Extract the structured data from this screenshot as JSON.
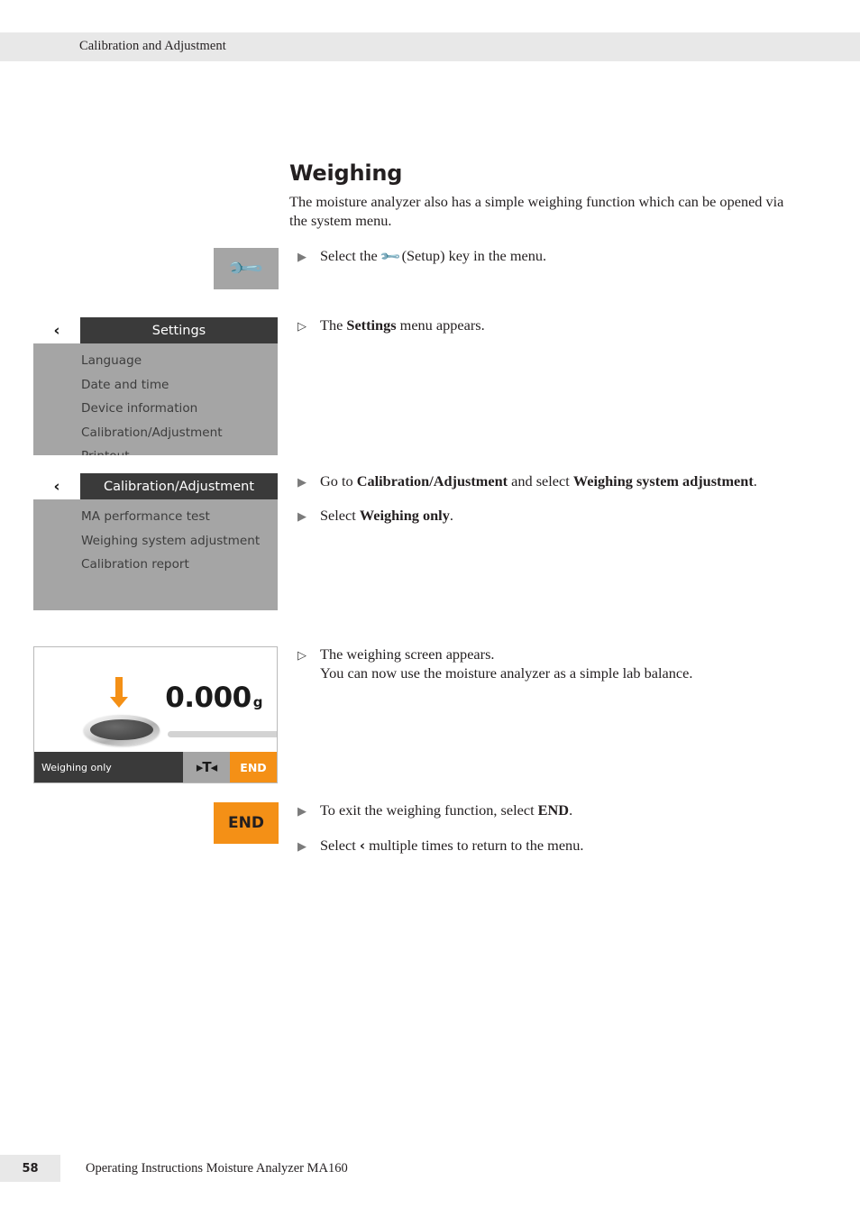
{
  "header": {
    "chapter": "Calibration and Adjustment"
  },
  "section": {
    "title": "Weighing",
    "intro": "The moisture analyzer also has a simple weighing function which can be opened via the system menu."
  },
  "steps": {
    "setup": {
      "marker": "▶",
      "prefix": "Select the ",
      "wrench_glyph": "🔧",
      "suffix": " (Setup) key in the menu."
    },
    "settings_appears": {
      "marker": "▷",
      "prefix": "The ",
      "bold": "Settings",
      "suffix": " menu appears."
    },
    "goto_calibration": {
      "marker": "▶",
      "prefix": "Go to ",
      "bold1": "Calibration/Adjustment",
      "middle": " and select ",
      "bold2": "Weighing system adjustment",
      "suffix": "."
    },
    "select_weighing_only": {
      "marker": "▶",
      "prefix": "Select ",
      "bold": "Weighing only",
      "suffix": "."
    },
    "screen_appears": {
      "marker": "▷",
      "line1": "The weighing screen appears.",
      "line2": "You can now use the moisture analyzer as a simple lab balance."
    },
    "exit": {
      "marker": "▶",
      "prefix": "To exit the weighing function, select ",
      "bold": "END",
      "suffix": "."
    },
    "back_to_menu": {
      "marker": "▶",
      "prefix": "Select ",
      "chevron_glyph": "‹",
      "suffix": " multiple times to return to the menu."
    }
  },
  "setup_key": {
    "icon": "wrench-icon",
    "glyph": "🔧"
  },
  "settings_panel": {
    "back_glyph": "‹",
    "title": "Settings",
    "items": [
      "Language",
      "Date and time",
      "Device information",
      "Calibration/Adjustment",
      "Printout"
    ]
  },
  "calibration_panel": {
    "back_glyph": "‹",
    "title": "Calibration/Adjustment",
    "items": [
      "MA performance test",
      "Weighing system adjustment",
      "Calibration report"
    ]
  },
  "weighing_screen": {
    "value": "0.000",
    "unit": "g",
    "mode_label": "Weighing only",
    "tare_label": "▸T◂",
    "end_label": "END"
  },
  "end_key": {
    "label": "END"
  },
  "footer": {
    "page_number": "58",
    "document_title": "Operating Instructions Moisture Analyzer MA160"
  },
  "colors": {
    "accent_orange": "#f49016",
    "panel_gray": "#a5a5a5",
    "titlebar_dark": "#3a3a3a",
    "header_band": "#e8e8e8"
  }
}
